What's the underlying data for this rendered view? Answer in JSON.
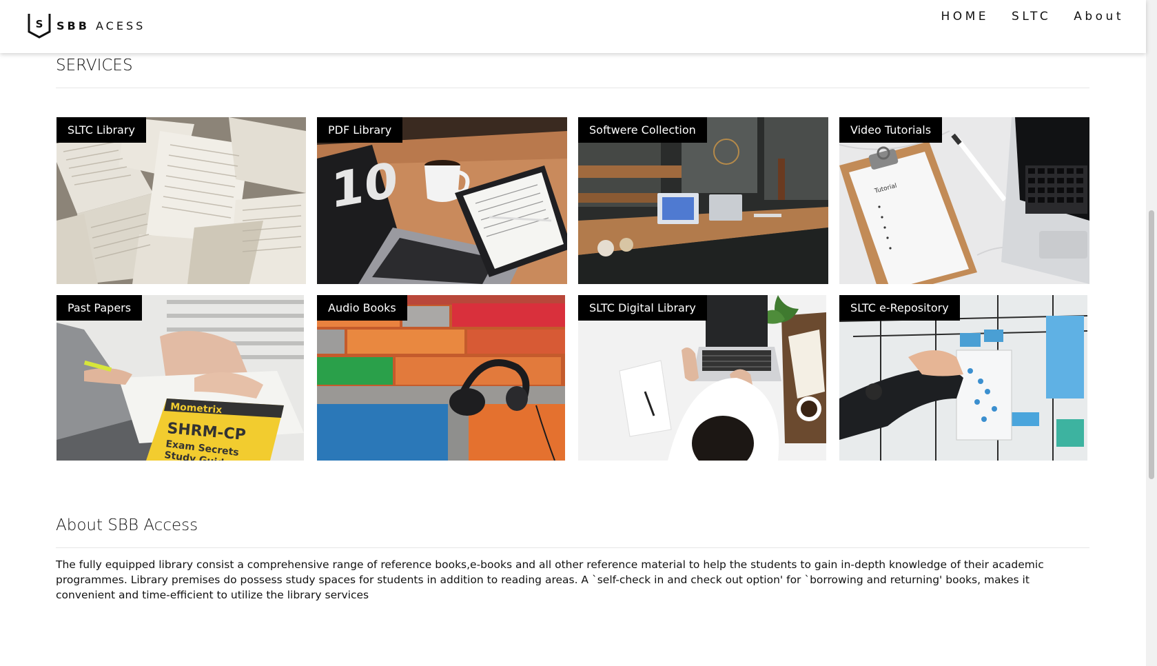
{
  "navbar": {
    "brand_letter": "S",
    "brand_bold": "SBB",
    "brand_rest": "ACESS",
    "links": [
      "HOME",
      "SLTC",
      "About"
    ]
  },
  "services": {
    "title": "SERVICES",
    "cards": [
      {
        "label": "SLTC Library",
        "image": "open-books-photo"
      },
      {
        "label": "PDF Library",
        "image": "laptop-tablet-coffee-photo"
      },
      {
        "label": "Softwere Collection",
        "image": "cafe-laptops-photo"
      },
      {
        "label": "Video Tutorials",
        "image": "clipboard-laptop-photo"
      },
      {
        "label": "Past Papers",
        "image": "study-guide-book-photo"
      },
      {
        "label": "Audio Books",
        "image": "headphones-brick-wall-photo"
      },
      {
        "label": "SLTC Digital Library",
        "image": "person-laptop-desk-photo"
      },
      {
        "label": "SLTC e-Repository",
        "image": "kanban-board-photo"
      }
    ]
  },
  "about": {
    "title": "About SBB Access",
    "body": "The fully equipped library consist a comprehensive range of reference books,e-books and all other reference material to help the students to gain in-depth knowledge of their academic programmes. Library premises do possess study spaces for students in addition to reading areas. A `self-check in and check out option' for `borrowing and returning' books, makes it convenient and time-efficient to utilize the library services"
  },
  "colors": {
    "label_bg": "#000000",
    "label_text": "#ffffff",
    "text": "#111111"
  }
}
